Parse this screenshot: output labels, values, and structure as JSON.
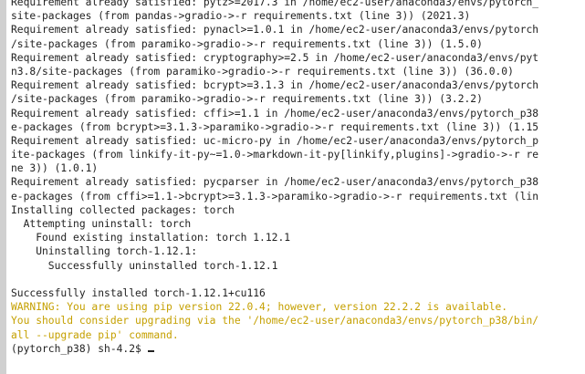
{
  "terminal": {
    "lines": [
      {
        "text": "Requirement already satisfied: pytz>=2017.3 in /home/ec2-user/anaconda3/envs/pytorch_",
        "kind": "normal"
      },
      {
        "text": "site-packages (from pandas->gradio->-r requirements.txt (line 3)) (2021.3)",
        "kind": "normal"
      },
      {
        "text": "Requirement already satisfied: pynacl>=1.0.1 in /home/ec2-user/anaconda3/envs/pytorch",
        "kind": "normal"
      },
      {
        "text": "/site-packages (from paramiko->gradio->-r requirements.txt (line 3)) (1.5.0)",
        "kind": "normal"
      },
      {
        "text": "Requirement already satisfied: cryptography>=2.5 in /home/ec2-user/anaconda3/envs/pyt",
        "kind": "normal"
      },
      {
        "text": "n3.8/site-packages (from paramiko->gradio->-r requirements.txt (line 3)) (36.0.0)",
        "kind": "normal"
      },
      {
        "text": "Requirement already satisfied: bcrypt>=3.1.3 in /home/ec2-user/anaconda3/envs/pytorch",
        "kind": "normal"
      },
      {
        "text": "/site-packages (from paramiko->gradio->-r requirements.txt (line 3)) (3.2.2)",
        "kind": "normal"
      },
      {
        "text": "Requirement already satisfied: cffi>=1.1 in /home/ec2-user/anaconda3/envs/pytorch_p38",
        "kind": "normal"
      },
      {
        "text": "e-packages (from bcrypt>=3.1.3->paramiko->gradio->-r requirements.txt (line 3)) (1.15",
        "kind": "normal"
      },
      {
        "text": "Requirement already satisfied: uc-micro-py in /home/ec2-user/anaconda3/envs/pytorch_p",
        "kind": "normal"
      },
      {
        "text": "ite-packages (from linkify-it-py~=1.0->markdown-it-py[linkify,plugins]->gradio->-r re",
        "kind": "normal"
      },
      {
        "text": "ne 3)) (1.0.1)",
        "kind": "normal"
      },
      {
        "text": "Requirement already satisfied: pycparser in /home/ec2-user/anaconda3/envs/pytorch_p38",
        "kind": "normal"
      },
      {
        "text": "e-packages (from cffi>=1.1->bcrypt>=3.1.3->paramiko->gradio->-r requirements.txt (lin",
        "kind": "normal"
      },
      {
        "text": "Installing collected packages: torch",
        "kind": "normal"
      },
      {
        "text": "  Attempting uninstall: torch",
        "kind": "normal"
      },
      {
        "text": "    Found existing installation: torch 1.12.1",
        "kind": "normal"
      },
      {
        "text": "    Uninstalling torch-1.12.1:",
        "kind": "normal"
      },
      {
        "text": "      Successfully uninstalled torch-1.12.1",
        "kind": "normal"
      },
      {
        "text": "",
        "kind": "normal"
      },
      {
        "text": "Successfully installed torch-1.12.1+cu116",
        "kind": "normal"
      },
      {
        "text": "WARNING: You are using pip version 22.0.4; however, version 22.2.2 is available.",
        "kind": "warn"
      },
      {
        "text": "You should consider upgrading via the '/home/ec2-user/anaconda3/envs/pytorch_p38/bin/",
        "kind": "warn"
      },
      {
        "text": "all --upgrade pip' command.",
        "kind": "warn"
      }
    ],
    "prompt": "(pytorch_p38) sh-4.2$ ",
    "colors": {
      "background": "#ffffff",
      "text": "#222222",
      "warning": "#c5a000",
      "scrollbar": "#d0d0d0"
    }
  }
}
